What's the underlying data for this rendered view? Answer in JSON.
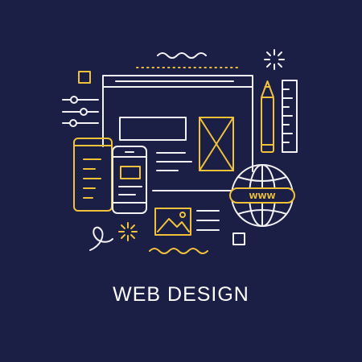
{
  "title": "WEB DESIGN",
  "globe_label": "WWW",
  "colors": {
    "background": "#1c1f45",
    "line_white": "#f2f2f5",
    "accent_yellow": "#f0c23c"
  },
  "icons": [
    "browser-window-icon",
    "pencil-icon",
    "ruler-icon",
    "globe-icon",
    "smartphone-icon",
    "tablet-icon",
    "image-icon",
    "sliders-icon",
    "sparkle-icon",
    "wave-icon"
  ]
}
